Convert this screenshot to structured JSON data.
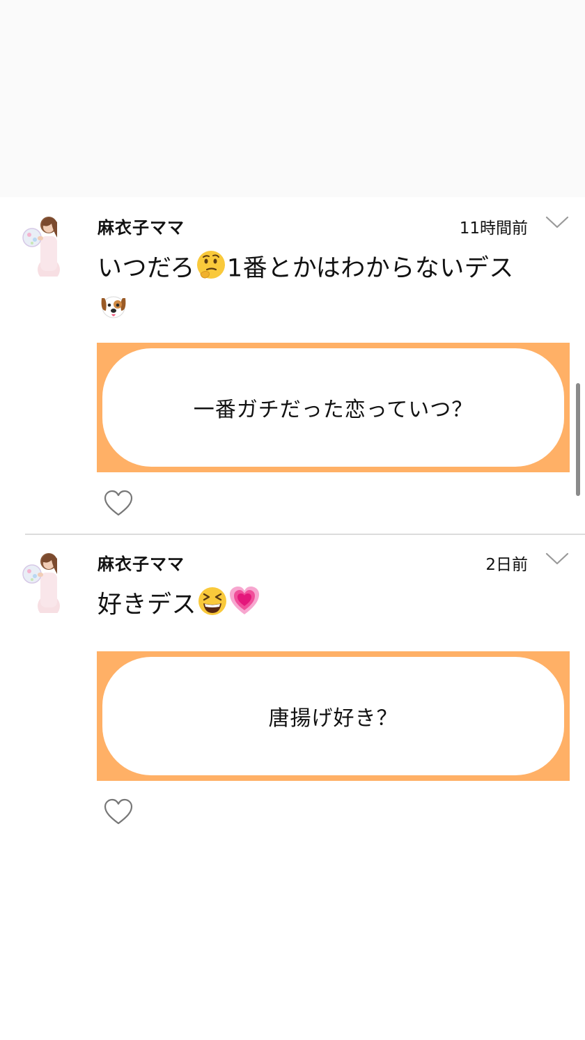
{
  "posts": [
    {
      "username": "麻衣子ママ",
      "timestamp": "11時間前",
      "body_text_1": "いつだろ",
      "body_emoji_1": "thinking-face",
      "body_text_2": "1番とかはわからないデス",
      "body_emoji_2": "dog-face",
      "card_text": "一番ガチだった恋っていつ？"
    },
    {
      "username": "麻衣子ママ",
      "timestamp": "2日前",
      "body_text_1": "好きデス",
      "body_emoji_1": "grinning-squinting-face",
      "body_emoji_2": "growing-heart",
      "card_text": "唐揚げ好き？"
    }
  ],
  "colors": {
    "card_border": "#ffb066",
    "separator": "#dcdcdc",
    "scrollbar": "#8a8a8a"
  }
}
